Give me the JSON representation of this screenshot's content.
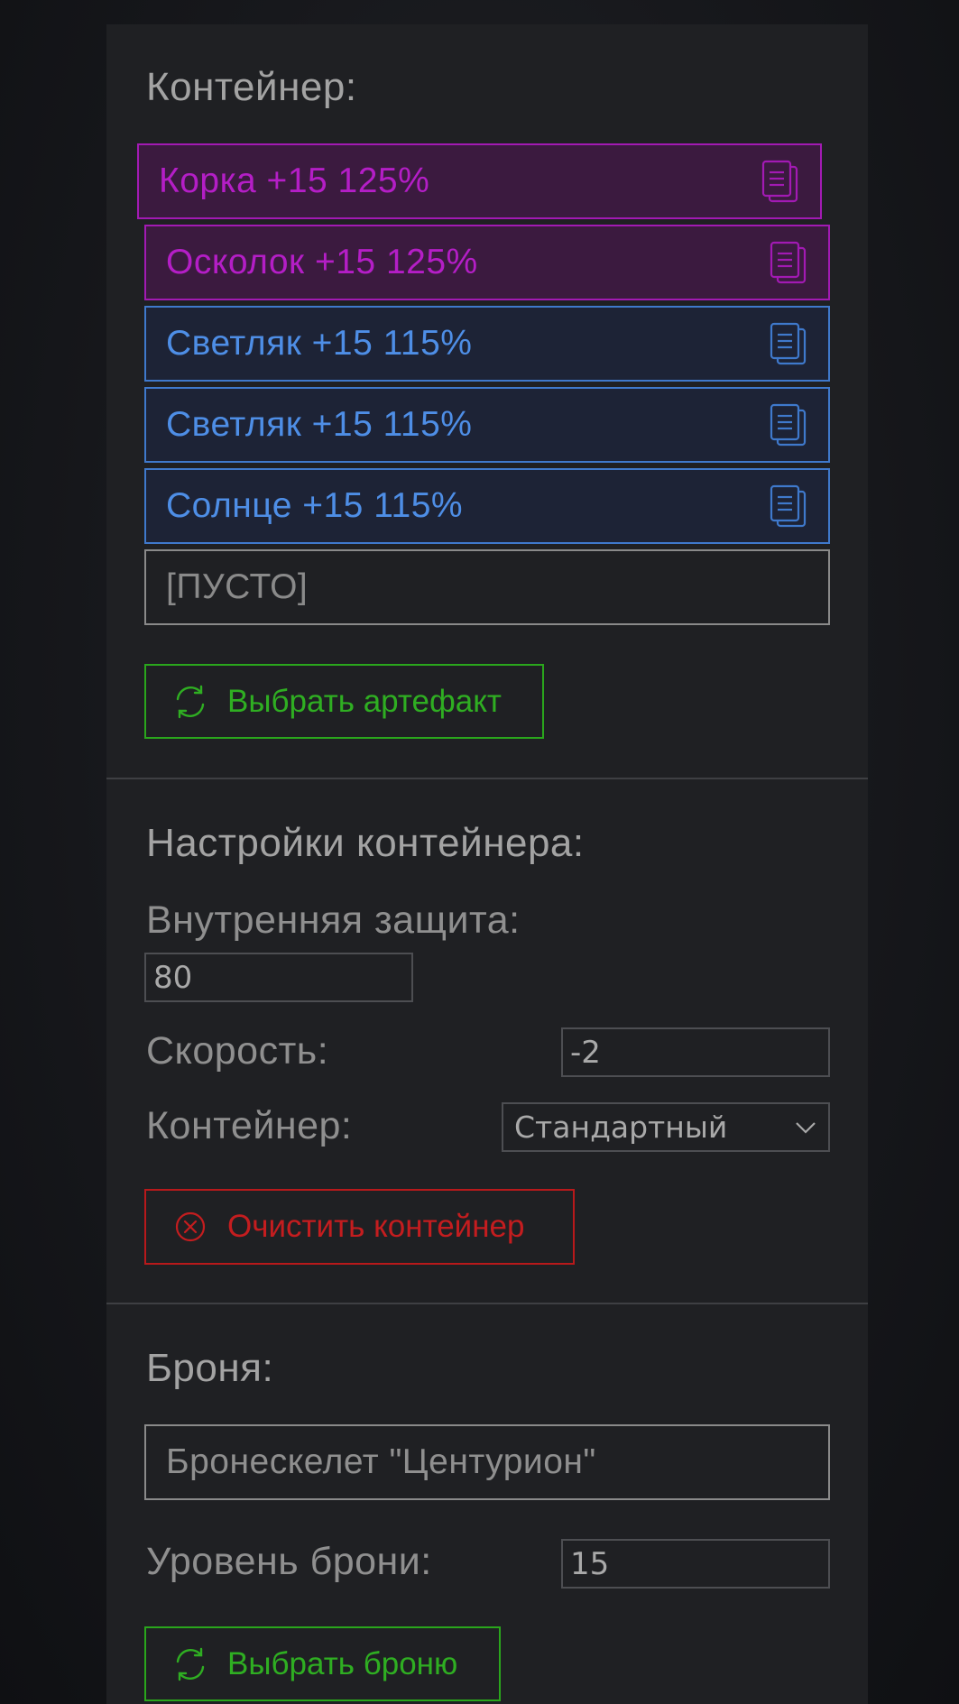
{
  "container_section": {
    "title": "Контейнер:",
    "artifacts": [
      {
        "label": "Корка +15 125%",
        "color": "#b41ec6",
        "icon": "copy-icon"
      },
      {
        "label": "Осколок +15 125%",
        "color": "#b41ec6",
        "icon": "copy-icon"
      },
      {
        "label": "Светляк +15 115%",
        "color": "#4e8ee6",
        "icon": "copy-icon"
      },
      {
        "label": "Светляк +15 115%",
        "color": "#4e8ee6",
        "icon": "copy-icon"
      },
      {
        "label": "Солнце +15 115%",
        "color": "#4e8ee6",
        "icon": "copy-icon"
      }
    ],
    "empty_slot": "[ПУСТО]",
    "choose_artifact_button": "Выбрать артефакт"
  },
  "settings_section": {
    "title": "Настройки контейнера:",
    "inner_protection_label": "Внутренняя защита:",
    "inner_protection_value": "80",
    "speed_label": "Скорость:",
    "speed_value": "-2",
    "container_label": "Контейнер:",
    "container_selected": "Стандартный",
    "clear_button": "Очистить контейнер"
  },
  "armor_section": {
    "title": "Броня:",
    "armor_name": "Бронескелет \"Центурион\"",
    "armor_level_label": "Уровень брони:",
    "armor_level_value": "15",
    "choose_armor_button": "Выбрать броню"
  },
  "colors": {
    "purple": "#b41ec6",
    "blue": "#4e8ee6",
    "green": "#2fae22",
    "red": "#c41d1f"
  }
}
